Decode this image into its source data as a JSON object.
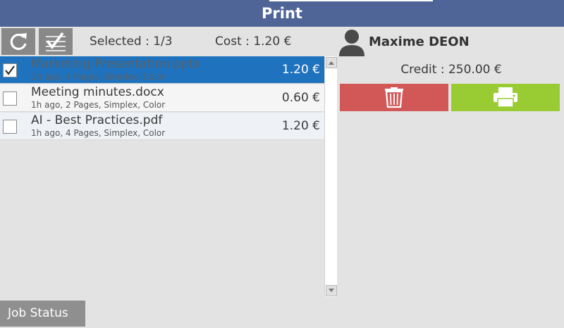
{
  "header": {
    "title": "Print"
  },
  "toolbar": {
    "refresh_icon": "refresh-icon",
    "select_all_icon": "checklist-icon",
    "selected_text": "Selected : 1/3",
    "cost_text": "Cost : 1.20 €"
  },
  "user": {
    "name": "Maxime DEON",
    "avatar_icon": "user-icon"
  },
  "jobs": [
    {
      "name": "Marketing Presentation.pptx",
      "meta": "1h ago, 4 Pages, Simplex, Color",
      "cost": "1.20 €",
      "checked": true
    },
    {
      "name": "Meeting minutes.docx",
      "meta": "1h ago, 2 Pages, Simplex, Color",
      "cost": "0.60 €",
      "checked": false
    },
    {
      "name": "AI - Best Practices.pdf",
      "meta": "1h ago, 4 Pages, Simplex, Color",
      "cost": "1.20 €",
      "checked": false
    }
  ],
  "account": {
    "credit_text": "Credit : 250.00 €"
  },
  "actions": {
    "delete_icon": "trash-icon",
    "print_icon": "printer-icon"
  },
  "footer": {
    "job_status_label": "Job Status"
  },
  "colors": {
    "header": "#4f6598",
    "selected_row": "#1f73be",
    "delete_button": "#d25858",
    "print_button": "#99cc33",
    "toolbar_button": "#888888"
  }
}
